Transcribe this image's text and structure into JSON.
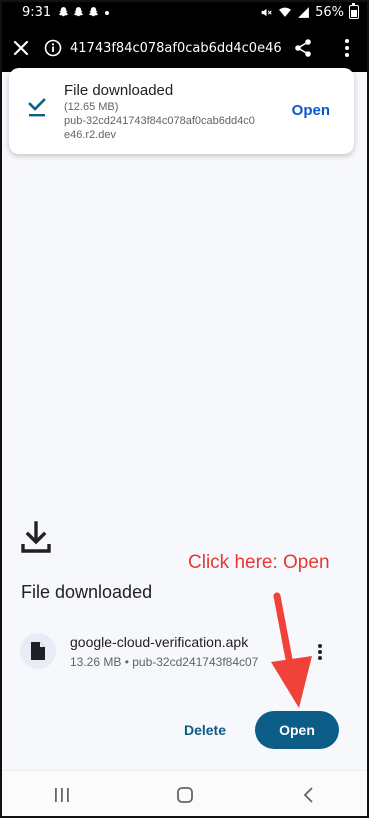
{
  "status_bar": {
    "time": "9:31",
    "battery": "56%",
    "icons": [
      "snapchat-icon",
      "snapchat-icon",
      "snapchat-icon",
      "dot-icon",
      "mute-icon",
      "wifi-icon",
      "signal-icon",
      "battery-icon"
    ]
  },
  "toolbar": {
    "url": "41743f84c078af0cab6dd4c0e46.r2.dev",
    "icons": [
      "close-icon",
      "info-icon",
      "share-icon",
      "more-vert-icon"
    ]
  },
  "toast": {
    "title": "File downloaded",
    "size": "(12.65 MB)",
    "url": "pub-32cd241743f84c078af0cab6dd4c0e46.r2.dev",
    "open_label": "Open"
  },
  "downloads": {
    "title": "File downloaded",
    "file_name": "google-cloud-verification.apk",
    "file_meta": "13.26 MB • pub-32cd241743f84c07",
    "delete_label": "Delete",
    "open_label": "Open"
  },
  "annotation": {
    "text": "Click here: Open",
    "color": "#e53935"
  },
  "nav_bar": {
    "icons": [
      "recents-icon",
      "home-icon",
      "back-icon"
    ]
  },
  "colors": {
    "accent": "#0b5d87",
    "link": "#0b57d0",
    "annotation": "#e53935",
    "background": "#f7f8fc"
  }
}
